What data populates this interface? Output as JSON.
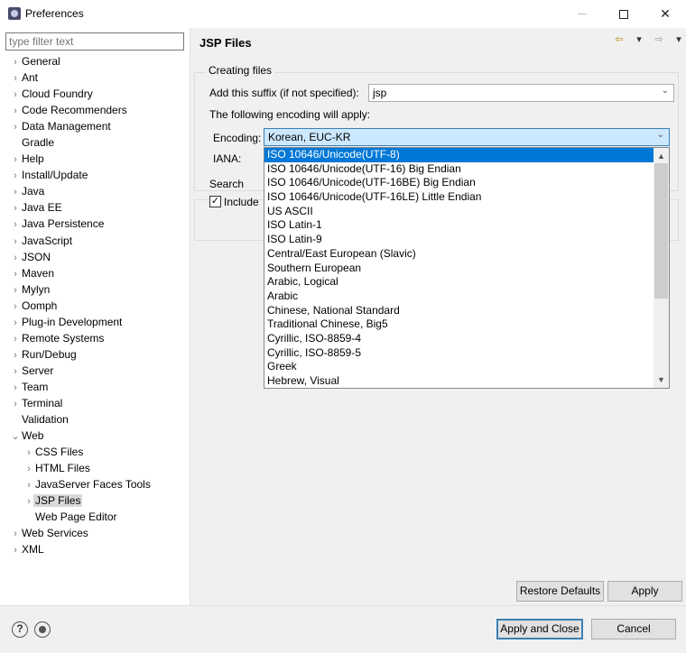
{
  "window": {
    "title": "Preferences",
    "minimize_glyph": "—",
    "maximize_glyph": "☐",
    "close_glyph": "✕"
  },
  "filter": {
    "placeholder": "type filter text",
    "value": ""
  },
  "tree": [
    {
      "label": "General",
      "arrow": "›",
      "level": 0
    },
    {
      "label": "Ant",
      "arrow": "›",
      "level": 0
    },
    {
      "label": "Cloud Foundry",
      "arrow": "›",
      "level": 0
    },
    {
      "label": "Code Recommenders",
      "arrow": "›",
      "level": 0
    },
    {
      "label": "Data Management",
      "arrow": "›",
      "level": 0
    },
    {
      "label": "Gradle",
      "arrow": "",
      "level": 0
    },
    {
      "label": "Help",
      "arrow": "›",
      "level": 0
    },
    {
      "label": "Install/Update",
      "arrow": "›",
      "level": 0
    },
    {
      "label": "Java",
      "arrow": "›",
      "level": 0
    },
    {
      "label": "Java EE",
      "arrow": "›",
      "level": 0
    },
    {
      "label": "Java Persistence",
      "arrow": "›",
      "level": 0
    },
    {
      "label": "JavaScript",
      "arrow": "›",
      "level": 0
    },
    {
      "label": "JSON",
      "arrow": "›",
      "level": 0
    },
    {
      "label": "Maven",
      "arrow": "›",
      "level": 0
    },
    {
      "label": "Mylyn",
      "arrow": "›",
      "level": 0
    },
    {
      "label": "Oomph",
      "arrow": "›",
      "level": 0
    },
    {
      "label": "Plug-in Development",
      "arrow": "›",
      "level": 0
    },
    {
      "label": "Remote Systems",
      "arrow": "›",
      "level": 0
    },
    {
      "label": "Run/Debug",
      "arrow": "›",
      "level": 0
    },
    {
      "label": "Server",
      "arrow": "›",
      "level": 0
    },
    {
      "label": "Team",
      "arrow": "›",
      "level": 0
    },
    {
      "label": "Terminal",
      "arrow": "›",
      "level": 0
    },
    {
      "label": "Validation",
      "arrow": "",
      "level": 0
    },
    {
      "label": "Web",
      "arrow": "⌄",
      "level": 0
    },
    {
      "label": "CSS Files",
      "arrow": "›",
      "level": 1
    },
    {
      "label": "HTML Files",
      "arrow": "›",
      "level": 1
    },
    {
      "label": "JavaServer Faces Tools",
      "arrow": "›",
      "level": 1
    },
    {
      "label": "JSP Files",
      "arrow": "›",
      "level": 1,
      "selected": true
    },
    {
      "label": "Web Page Editor",
      "arrow": "",
      "level": 1
    },
    {
      "label": "Web Services",
      "arrow": "›",
      "level": 0
    },
    {
      "label": "XML",
      "arrow": "›",
      "level": 0
    }
  ],
  "page": {
    "title": "JSP Files",
    "nav_back": "⇦",
    "nav_menu": "▾",
    "nav_forward": "⇨",
    "creating_files_label": "Creating files",
    "suffix_label": "Add this suffix (if not specified):",
    "suffix_value": "jsp",
    "encoding_apply_label": "The following encoding will apply:",
    "encoding_label": "Encoding:",
    "encoding_value": "Korean, EUC-KR",
    "iana_label": "IANA:",
    "search_label": "Search",
    "include_label": "Include",
    "include_checked": true,
    "check_glyph": "✓",
    "restore_defaults": "Restore Defaults",
    "apply": "Apply"
  },
  "dropdown": {
    "items": [
      "ISO 10646/Unicode(UTF-8)",
      "ISO 10646/Unicode(UTF-16) Big Endian",
      "ISO 10646/Unicode(UTF-16BE) Big Endian",
      "ISO 10646/Unicode(UTF-16LE) Little Endian",
      "US ASCII",
      "ISO Latin-1",
      "ISO Latin-9",
      "Central/East European (Slavic)",
      "Southern European",
      "Arabic, Logical",
      "Arabic",
      "Chinese, National Standard",
      "Traditional Chinese, Big5",
      "Cyrillic, ISO-8859-4",
      "Cyrillic, ISO-8859-5",
      "Greek",
      "Hebrew, Visual"
    ],
    "selected_index": 0
  },
  "footer": {
    "apply_and_close": "Apply and Close",
    "cancel": "Cancel",
    "help_glyph": "?"
  }
}
